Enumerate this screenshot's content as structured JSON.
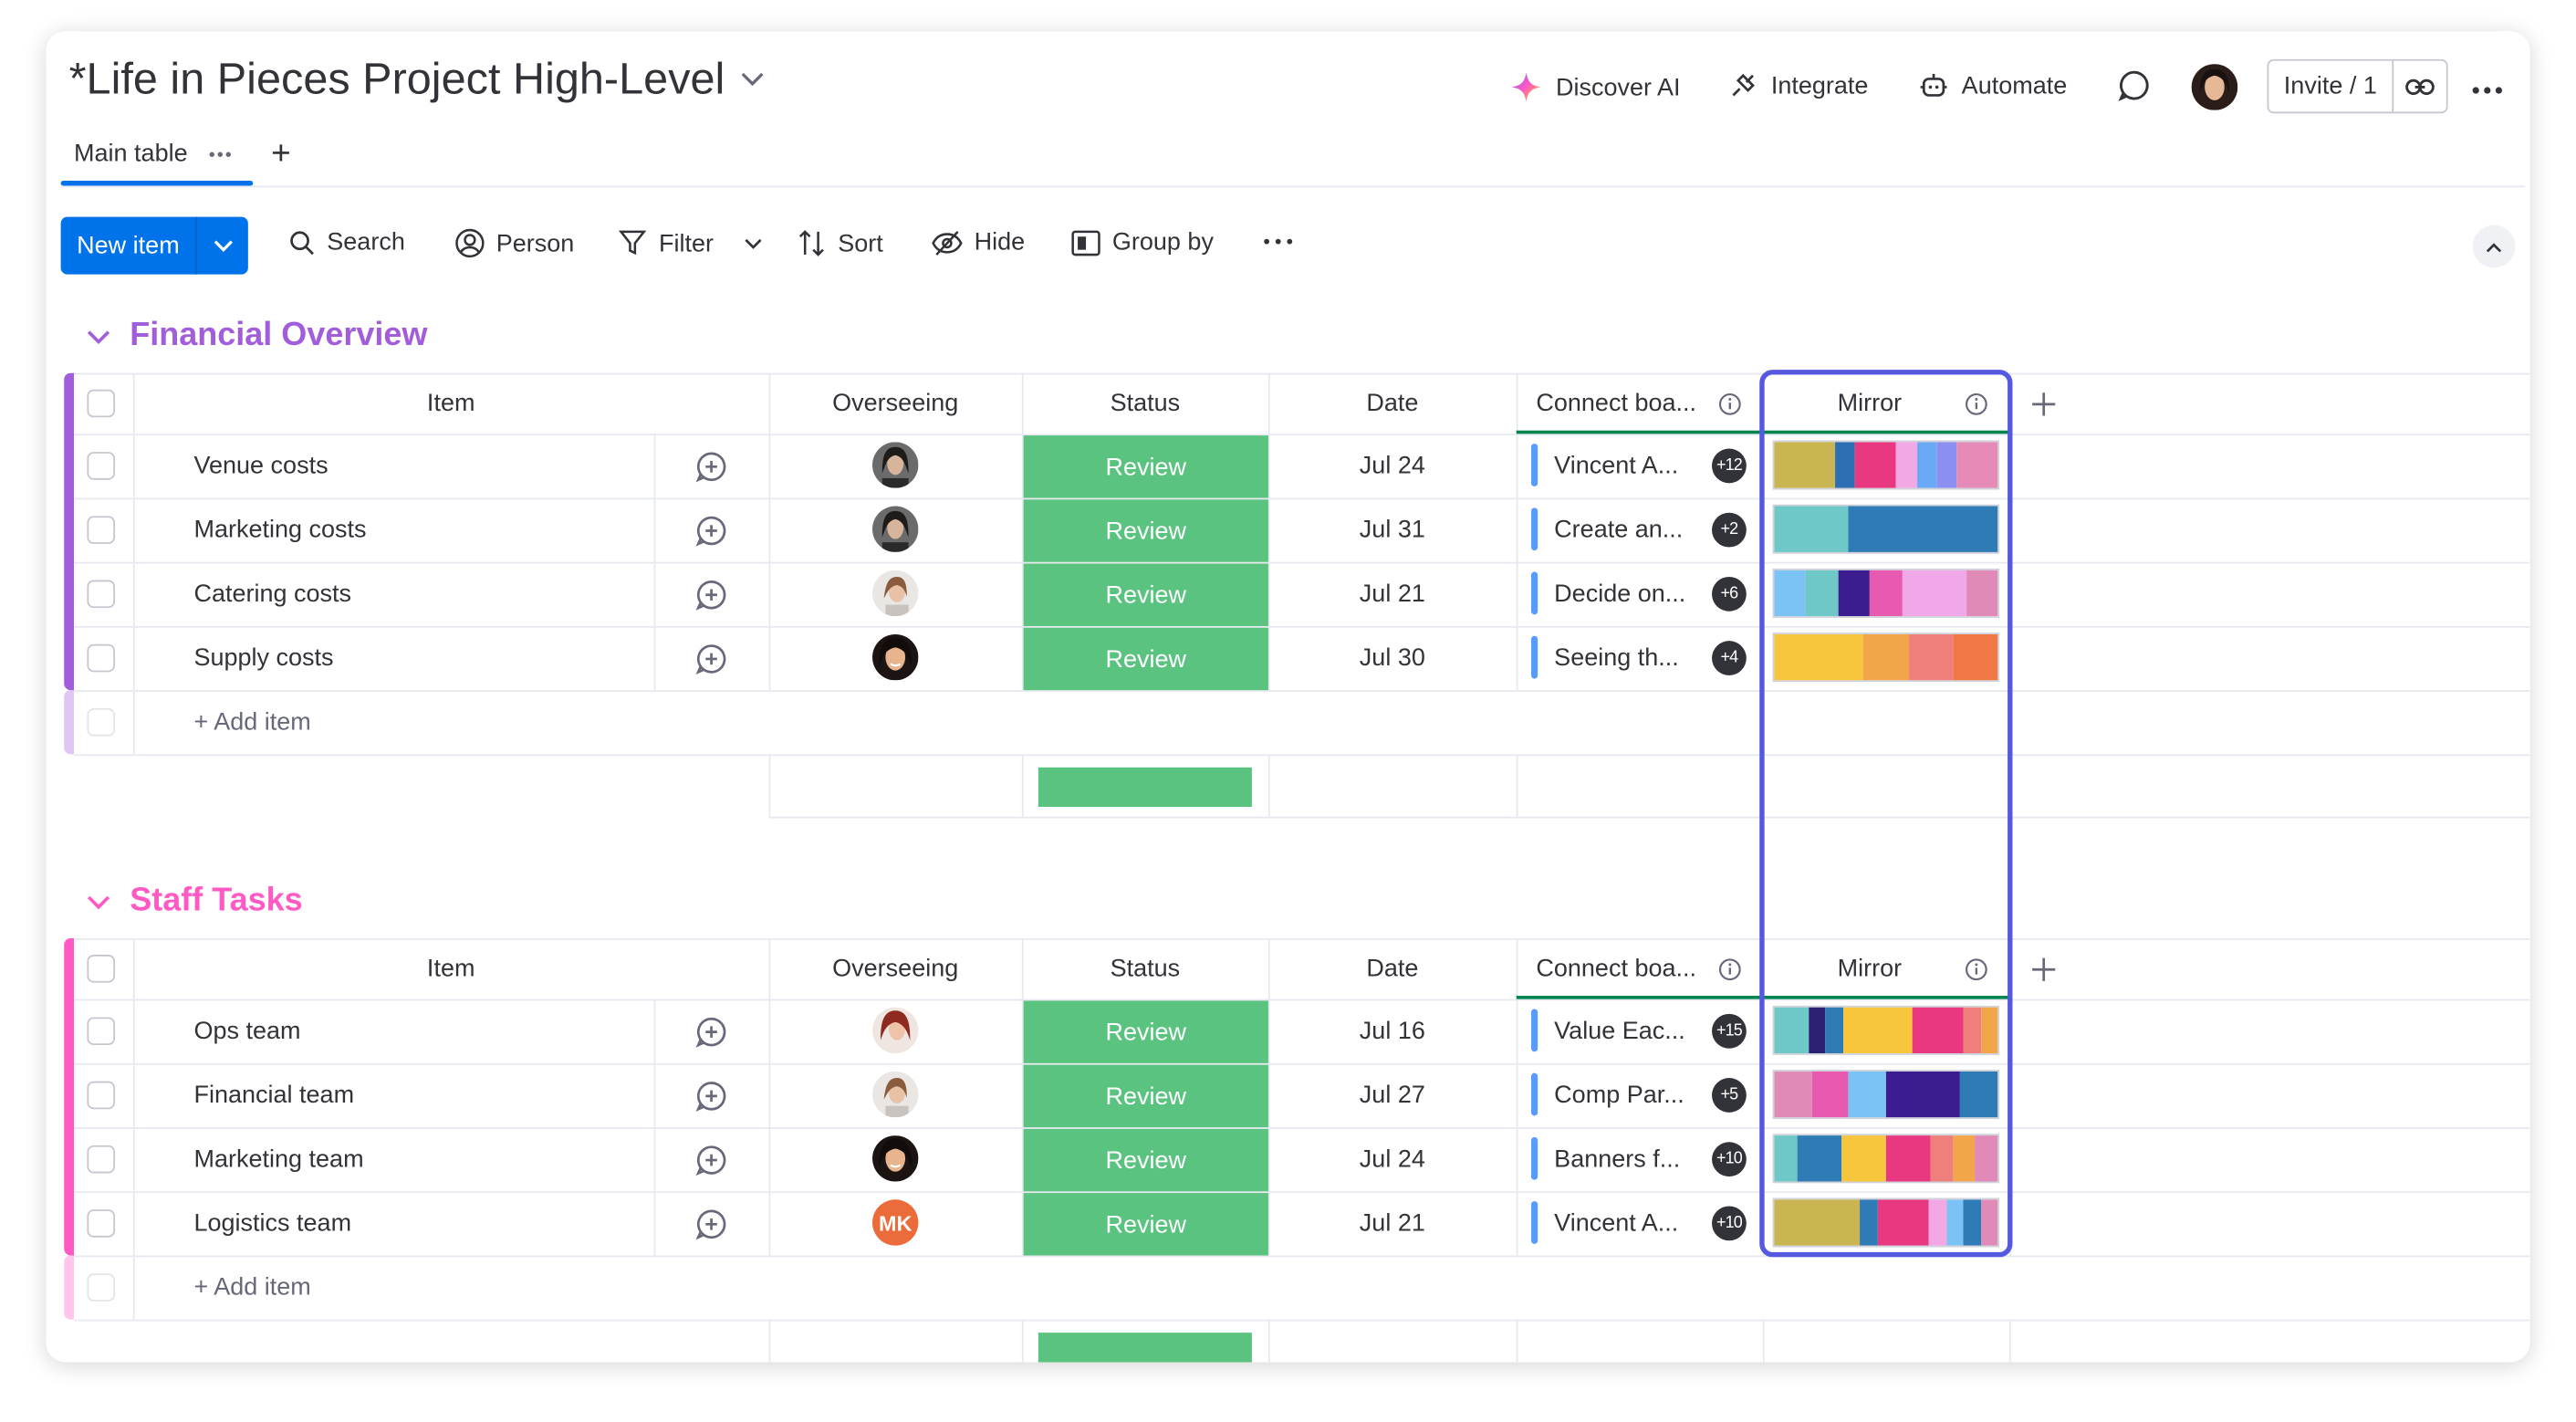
{
  "header": {
    "title": "*Life in Pieces Project High-Level",
    "actions": [
      "Discover AI",
      "Integrate",
      "Automate"
    ],
    "invite_label": "Invite / 1"
  },
  "tabs": [
    {
      "label": "Main table"
    }
  ],
  "toolbar": {
    "new_item": "New item",
    "search": "Search",
    "person": "Person",
    "filter": "Filter",
    "sort": "Sort",
    "hide": "Hide",
    "group_by": "Group by"
  },
  "columns": {
    "item": "Item",
    "overseeing": "Overseeing",
    "status": "Status",
    "date": "Date",
    "connect": "Connect boa...",
    "mirror": "Mirror"
  },
  "add_item": "+ Add item",
  "colors": {
    "accent": "#0073ea",
    "status_review": "#5ac37f",
    "mirror_highlight": "#5559df",
    "group_1": "#a25ddc",
    "group_2": "#ff5ac4"
  },
  "groups": [
    {
      "title": "Financial Overview",
      "color": "#a25ddc",
      "rows": [
        {
          "item": "Venue costs",
          "person": "avatar-dark-hair",
          "status": "Review",
          "date": "Jul 24",
          "connect": "Vincent A...",
          "connect_count": "+12",
          "mirror": [
            [
              "#c9b552",
              3
            ],
            [
              "#2e6eb5",
              1
            ],
            [
              "#e8387f",
              2
            ],
            [
              "#f1a8e4",
              1
            ],
            [
              "#6aa9f5",
              1
            ],
            [
              "#8c8ff0",
              1
            ],
            [
              "#e68ab8",
              2
            ]
          ]
        },
        {
          "item": "Marketing costs",
          "person": "avatar-dark-hair",
          "status": "Review",
          "date": "Jul 31",
          "connect": "Create an...",
          "connect_count": "+2",
          "mirror": [
            [
              "#6fc8c8",
              1
            ],
            [
              "#2f7bb6",
              2
            ]
          ]
        },
        {
          "item": "Catering costs",
          "person": "avatar-light",
          "status": "Review",
          "date": "Jul 21",
          "connect": "Decide on...",
          "connect_count": "+6",
          "mirror": [
            [
              "#7cc3f5",
              1
            ],
            [
              "#6fc8c8",
              1
            ],
            [
              "#3b1d8f",
              1
            ],
            [
              "#e85aaf",
              1
            ],
            [
              "#f0a8e8",
              2
            ],
            [
              "#e08ab8",
              1
            ]
          ]
        },
        {
          "item": "Supply costs",
          "person": "avatar-smile",
          "status": "Review",
          "date": "Jul 30",
          "connect": "Seeing th...",
          "connect_count": "+4",
          "mirror": [
            [
              "#f7c63d",
              2
            ],
            [
              "#f3a54a",
              1
            ],
            [
              "#ee7f7a",
              1
            ],
            [
              "#f07845",
              1
            ]
          ]
        }
      ]
    },
    {
      "title": "Staff Tasks",
      "color": "#ff5ac4",
      "rows": [
        {
          "item": "Ops team",
          "person": "avatar-red-hair",
          "status": "Review",
          "date": "Jul 16",
          "connect": "Value Eac...",
          "connect_count": "+15",
          "mirror": [
            [
              "#6fc8c8",
              2
            ],
            [
              "#2a2170",
              1
            ],
            [
              "#2f7bb6",
              1
            ],
            [
              "#f7c63d",
              4
            ],
            [
              "#e8387f",
              3
            ],
            [
              "#ee7f7a",
              1
            ],
            [
              "#f3a54a",
              1
            ]
          ]
        },
        {
          "item": "Financial team",
          "person": "avatar-light",
          "status": "Review",
          "date": "Jul 27",
          "connect": "Comp Par...",
          "connect_count": "+5",
          "mirror": [
            [
              "#e08ab8",
              1
            ],
            [
              "#e85aaf",
              1
            ],
            [
              "#7cc3f5",
              1
            ],
            [
              "#3b1d8f",
              2
            ],
            [
              "#2f7bb6",
              1
            ]
          ]
        },
        {
          "item": "Marketing team",
          "person": "avatar-smile",
          "status": "Review",
          "date": "Jul 24",
          "connect": "Banners f...",
          "connect_count": "+10",
          "mirror": [
            [
              "#6fc8c8",
              1
            ],
            [
              "#2f7bb6",
              2
            ],
            [
              "#f7c63d",
              2
            ],
            [
              "#e8387f",
              2
            ],
            [
              "#ee7f7a",
              1
            ],
            [
              "#f3a54a",
              1
            ],
            [
              "#e08ab8",
              1
            ]
          ]
        },
        {
          "item": "Logistics team",
          "person": "MK",
          "status": "Review",
          "date": "Jul 21",
          "connect": "Vincent A...",
          "connect_count": "+10",
          "mirror": [
            [
              "#c9b552",
              5
            ],
            [
              "#2f7bb6",
              1
            ],
            [
              "#e8387f",
              3
            ],
            [
              "#f1a8e4",
              1
            ],
            [
              "#7cc3f5",
              1
            ],
            [
              "#2f7bb6",
              1
            ],
            [
              "#e08ab8",
              1
            ]
          ]
        }
      ]
    }
  ]
}
